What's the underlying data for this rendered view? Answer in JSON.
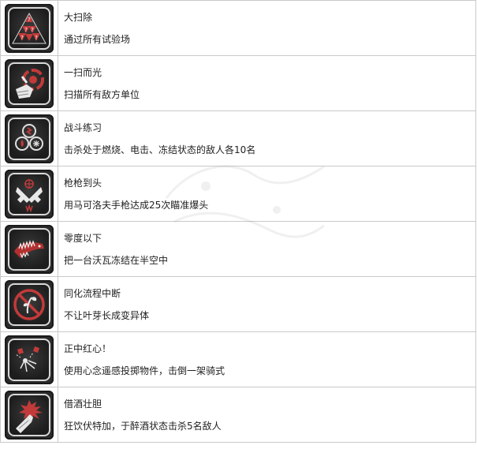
{
  "achievements": [
    {
      "title": "大扫除",
      "desc": "通过所有试验场",
      "icon": "triangle-hazard-icon"
    },
    {
      "title": "一扫而光",
      "desc": "扫描所有敌方单位",
      "icon": "scanner-hand-icon"
    },
    {
      "title": "战斗练习",
      "desc": "击杀处于燃烧、电击、冻结状态的敌人各10名",
      "icon": "elements-triad-icon"
    },
    {
      "title": "枪枪到头",
      "desc": "用马可洛夫手枪达成25次瞄准爆头",
      "icon": "crossed-pistols-icon"
    },
    {
      "title": "零度以下",
      "desc": "把一台沃瓦冻结在半空中",
      "icon": "frozen-creature-icon"
    },
    {
      "title": "同化流程中断",
      "desc": "不让叶芽长成变异体",
      "icon": "no-sprout-icon"
    },
    {
      "title": "正中红心！",
      "desc": "使用心念遥感投掷物件，击倒一架骑式",
      "icon": "telekinesis-throw-icon"
    },
    {
      "title": "借酒壮胆",
      "desc": "狂饮伏特加，于醉酒状态击杀5名敌人",
      "icon": "vodka-bottle-icon"
    }
  ],
  "colors": {
    "badge_bg": "#2b2b2b",
    "badge_border": "#d8d8d8",
    "accent_red": "#c23a3a",
    "grid_line": "#c9c9c9"
  }
}
